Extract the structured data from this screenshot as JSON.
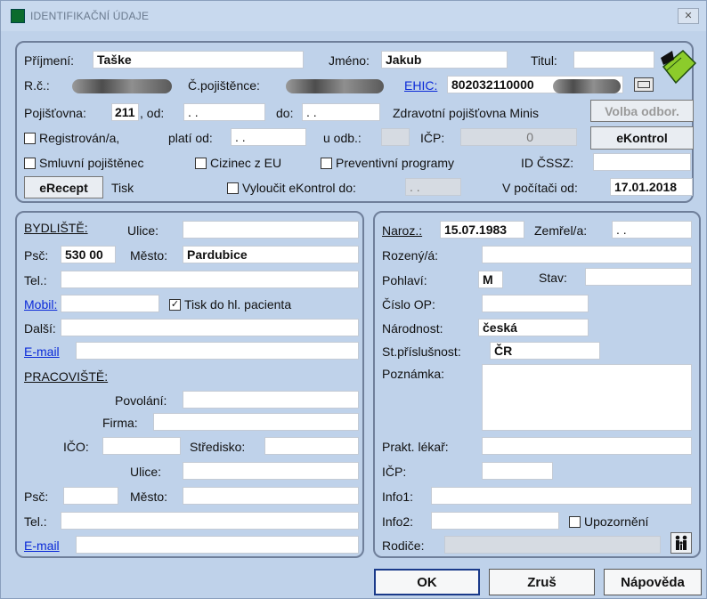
{
  "window": {
    "title": "IDENTIFIKAČNÍ ÚDAJE",
    "close": "✕"
  },
  "top": {
    "prijmeni_label": "Příjmení:",
    "prijmeni": "Taške",
    "jmeno_label": "Jméno:",
    "jmeno": "Jakub",
    "titul_label": "Titul:",
    "titul": "",
    "rc_label": "R.č.:",
    "cislo_pojistence_label": "Č.pojištěnce:",
    "ehic_label": "EHIC:",
    "ehic_value": "802032110000",
    "pojistovna_label": "Pojišťovna:",
    "pojistovna": "211",
    "od_label": ", od:",
    "od": ". .",
    "do_label": "do:",
    "do": ". .",
    "pojistovna_name": "Zdravotní pojišťovna Minis",
    "volba_odbor": "Volba odbor.",
    "registrovan_label": "Registrován/a,",
    "plati_od_label": "platí od:",
    "plati_od": ". .",
    "u_odb_label": "u odb.:",
    "icp_label": "IČP:",
    "icp_value": "0",
    "ekontrol": "eKontrol",
    "smluvni_label": "Smluvní pojištěnec",
    "cizinec_label": "Cizinec z EU",
    "preventivni_label": "Preventivní programy",
    "id_cssz_label": "ID ČSSZ:",
    "erecept": "eRecept",
    "tisk": "Tisk",
    "vyloucit_label": "Vyloučit eKontrol do:",
    "vyloucit_value": ". .",
    "v_pocitaci_label": "V počítači od:",
    "v_pocitaci": "17.01.2018"
  },
  "left": {
    "bydliste": "BYDLIŠTĚ:",
    "ulice_label": "Ulice:",
    "psc_label": "Psč:",
    "psc": "530 00",
    "mesto_label": "Město:",
    "mesto": "Pardubice",
    "tel_label": "Tel.:",
    "mobil_label": "Mobil:",
    "tisk_do_label": "Tisk do hl. pacienta",
    "dalsi_label": "Další:",
    "email_label": "E-mail",
    "pracoviste": "PRACOVIŠTĚ:",
    "povolani_label": "Povolání:",
    "firma_label": "Firma:",
    "ico_label": "IČO:",
    "stredisko_label": "Středisko:",
    "ulice2_label": "Ulice:",
    "psc2_label": "Psč:",
    "mesto2_label": "Město:",
    "tel2_label": "Tel.:",
    "email2_label": "E-mail"
  },
  "right": {
    "naroz_label": "Naroz.:",
    "naroz": "15.07.1983",
    "zemrel_label": "Zemřel/a:",
    "zemrel": ". .",
    "rozeny_label": "Rozený/á:",
    "pohlavi_label": "Pohlaví:",
    "pohlavi": "M",
    "stav_label": "Stav:",
    "cislo_op_label": "Číslo OP:",
    "narodnost_label": "Národnost:",
    "narodnost": "česká",
    "st_prislusnost_label": "St.příslušnost:",
    "st_prislusnost": "ČR",
    "poznamka_label": "Poznámka:",
    "prakt_lekar_label": "Prakt. lékař:",
    "icp_label": "IČP:",
    "info1_label": "Info1:",
    "info2_label": "Info2:",
    "upozorneni_label": "Upozornění",
    "rodice_label": "Rodiče:"
  },
  "buttons": {
    "ok": "OK",
    "zrus": "Zruš",
    "napoveda": "Nápověda"
  }
}
